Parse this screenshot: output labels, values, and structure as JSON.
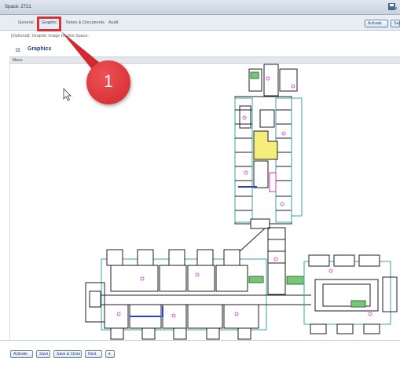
{
  "window": {
    "title": "Space: 2721"
  },
  "tabs": [
    {
      "label": "General"
    },
    {
      "label": "Graphic"
    },
    {
      "label": "Notes & Documents"
    },
    {
      "label": "Audit"
    }
  ],
  "toolbar": {
    "activate_label": "Activate",
    "save_label": "Save"
  },
  "hint_text": "[Optional]: Graphic image for this Space.",
  "section": {
    "title": "Graphics"
  },
  "menu": {
    "label": "Menu"
  },
  "callout": {
    "number": "1"
  },
  "footer": {
    "activate_label": "Activate",
    "save_label": "Save",
    "save_close_label": "Save & Close",
    "next_label": "Next"
  },
  "colors": {
    "highlight": "#d6323a",
    "room_yellow": "#f6ee7a",
    "wall": "#1e1e1e",
    "teal": "#3aa6a6",
    "magenta": "#cc2fcc"
  }
}
